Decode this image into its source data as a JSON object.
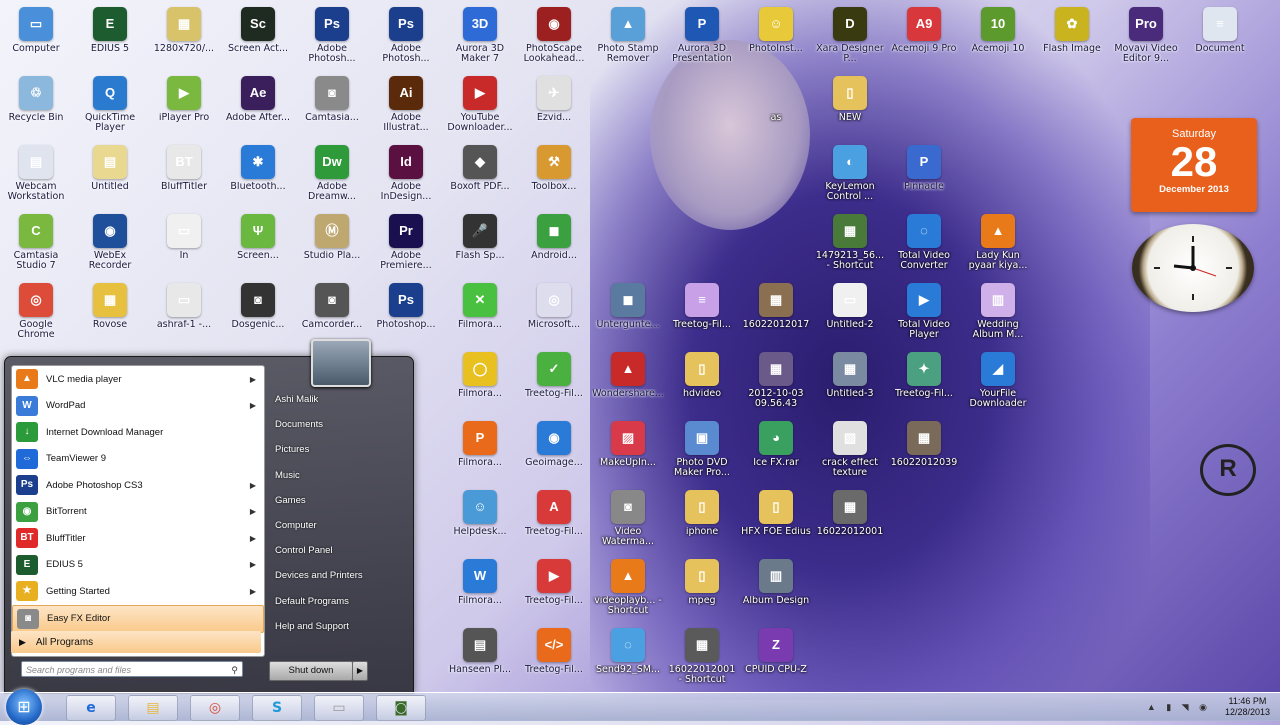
{
  "desktop_icons": [
    {
      "label": "Computer",
      "col": 0,
      "row": 0,
      "color": "#4a8fd9",
      "glyph": "▭"
    },
    {
      "label": "EDIUS 5",
      "col": 1,
      "row": 0,
      "color": "#1d5c2e",
      "glyph": "E"
    },
    {
      "label": "1280x720/...",
      "col": 2,
      "row": 0,
      "color": "#d8c36b",
      "glyph": "▦"
    },
    {
      "label": "Screen Act...",
      "col": 3,
      "row": 0,
      "color": "#1f2a20",
      "glyph": "Sc"
    },
    {
      "label": "Adobe Photosh...",
      "col": 4,
      "row": 0,
      "color": "#1b3f8c",
      "glyph": "Ps"
    },
    {
      "label": "Adobe Photosh...",
      "col": 5,
      "row": 0,
      "color": "#1b3f8c",
      "glyph": "Ps"
    },
    {
      "label": "Aurora 3D Maker 7",
      "col": 6,
      "row": 0,
      "color": "#2e6bd6",
      "glyph": "3D"
    },
    {
      "label": "PhotoScape Lookahead...",
      "col": 7,
      "row": 0,
      "color": "#9c2020",
      "glyph": "◉"
    },
    {
      "label": "Photo Stamp Remover",
      "col": 8,
      "row": 0,
      "color": "#5aa0d8",
      "glyph": "▲"
    },
    {
      "label": "Aurora 3D Presentation",
      "col": 9,
      "row": 0,
      "color": "#1f57b5",
      "glyph": "P"
    },
    {
      "label": "PhotoInst...",
      "col": 10,
      "row": 0,
      "color": "#e8c93a",
      "glyph": "☺"
    },
    {
      "label": "Xara Designer P...",
      "col": 11,
      "row": 0,
      "color": "#3a3a10",
      "glyph": "D"
    },
    {
      "label": "Acemoji 9 Pro",
      "col": 12,
      "row": 0,
      "color": "#d8373b",
      "glyph": "A9"
    },
    {
      "label": "Acemoji 10",
      "col": 13,
      "row": 0,
      "color": "#5c9a2e",
      "glyph": "10"
    },
    {
      "label": "Flash Image",
      "col": 14,
      "row": 0,
      "color": "#c9b420",
      "glyph": "✿"
    },
    {
      "label": "Movavi Video Editor 9...",
      "col": 15,
      "row": 0,
      "color": "#4a2a7a",
      "glyph": "Pro"
    },
    {
      "label": "Document",
      "col": 16,
      "row": 0,
      "color": "#dfe6f0",
      "glyph": "≡"
    },
    {
      "label": "Recycle Bin",
      "col": 0,
      "row": 1,
      "color": "#8db8de",
      "glyph": "♲"
    },
    {
      "label": "QuickTime Player",
      "col": 1,
      "row": 1,
      "color": "#2a7bd0",
      "glyph": "Q"
    },
    {
      "label": "iPlayer Pro",
      "col": 2,
      "row": 1,
      "color": "#7ab840",
      "glyph": "▶"
    },
    {
      "label": "Adobe After...",
      "col": 3,
      "row": 1,
      "color": "#3a1f5c",
      "glyph": "Ae"
    },
    {
      "label": "Camtasia...",
      "col": 4,
      "row": 1,
      "color": "#8a8a8a",
      "glyph": "◙"
    },
    {
      "label": "Adobe Illustrat...",
      "col": 5,
      "row": 1,
      "color": "#5a2a0a",
      "glyph": "Ai"
    },
    {
      "label": "YouTube Downloader...",
      "col": 6,
      "row": 1,
      "color": "#c82a2a",
      "glyph": "▶"
    },
    {
      "label": "Ezvid...",
      "col": 7,
      "row": 1,
      "color": "#e0e0e0",
      "glyph": "✈"
    },
    {
      "label": "as",
      "col": 10,
      "row": 1,
      "color": "rgba(0,0,0,0)",
      "glyph": "",
      "dark": true
    },
    {
      "label": "NEW",
      "col": 11,
      "row": 1,
      "color": "#e6c25c",
      "glyph": "▯",
      "dark": true
    },
    {
      "label": "Webcam Workstation",
      "col": 0,
      "row": 2,
      "color": "#dfe4ee",
      "glyph": "▤"
    },
    {
      "label": "Untitled",
      "col": 1,
      "row": 2,
      "color": "#e8d890",
      "glyph": "▤"
    },
    {
      "label": "BluffTitler",
      "col": 2,
      "row": 2,
      "color": "#e8e8e8",
      "glyph": "BT"
    },
    {
      "label": "Bluetooth...",
      "col": 3,
      "row": 2,
      "color": "#2a7ad8",
      "glyph": "✱"
    },
    {
      "label": "Adobe Dreamw...",
      "col": 4,
      "row": 2,
      "color": "#2e9a3a",
      "glyph": "Dw"
    },
    {
      "label": "Adobe InDesign...",
      "col": 5,
      "row": 2,
      "color": "#5a1040",
      "glyph": "Id"
    },
    {
      "label": "Boxoft PDF...",
      "col": 6,
      "row": 2,
      "color": "#555",
      "glyph": "◆"
    },
    {
      "label": "Toolbox...",
      "col": 7,
      "row": 2,
      "color": "#d89a30",
      "glyph": "⚒"
    },
    {
      "label": "KeyLemon Control ...",
      "col": 11,
      "row": 2,
      "color": "#4aa0e0",
      "glyph": "◐",
      "dark": true
    },
    {
      "label": "Pinnacle",
      "col": 12,
      "row": 2,
      "color": "#3a6ad0",
      "glyph": "P"
    },
    {
      "label": "Camtasia Studio 7",
      "col": 0,
      "row": 3,
      "color": "#7ab840",
      "glyph": "C"
    },
    {
      "label": "WebEx Recorder",
      "col": 1,
      "row": 3,
      "color": "#1f4f9a",
      "glyph": "◉"
    },
    {
      "label": "In",
      "col": 2,
      "row": 3,
      "color": "#f0f0f0",
      "glyph": "▭"
    },
    {
      "label": "Screen...",
      "col": 3,
      "row": 3,
      "color": "#6ab840",
      "glyph": "Ψ"
    },
    {
      "label": "Studio Pla...",
      "col": 4,
      "row": 3,
      "color": "#bfa870",
      "glyph": "Ⓜ"
    },
    {
      "label": "Adobe Premiere...",
      "col": 5,
      "row": 3,
      "color": "#1a1050",
      "glyph": "Pr"
    },
    {
      "label": "Flash Sp...",
      "col": 6,
      "row": 3,
      "color": "#333",
      "glyph": "🎤"
    },
    {
      "label": "Android...",
      "col": 7,
      "row": 3,
      "color": "#3aa040",
      "glyph": "◼"
    },
    {
      "label": "1479213_56... - Shortcut",
      "col": 11,
      "row": 3,
      "color": "#4a7a3a",
      "glyph": "▦",
      "dark": true
    },
    {
      "label": "Total Video Converter",
      "col": 12,
      "row": 3,
      "color": "#2a7ad8",
      "glyph": "◌",
      "dark": true
    },
    {
      "label": "Lady Kun pyaar kiya...",
      "col": 13,
      "row": 3,
      "color": "#e87a1a",
      "glyph": "▲",
      "dark": true
    },
    {
      "label": "Google Chrome",
      "col": 0,
      "row": 4,
      "color": "#dd4b39",
      "glyph": "◎"
    },
    {
      "label": "Rovose",
      "col": 1,
      "row": 4,
      "color": "#e8c040",
      "glyph": "▦"
    },
    {
      "label": "ashraf-1 -...",
      "col": 2,
      "row": 4,
      "color": "#e8e8e8",
      "glyph": "▭"
    },
    {
      "label": "Dosgenic...",
      "col": 3,
      "row": 4,
      "color": "#333",
      "glyph": "◙"
    },
    {
      "label": "Camcorder...",
      "col": 4,
      "row": 4,
      "color": "#555",
      "glyph": "◙"
    },
    {
      "label": "Photoshop...",
      "col": 5,
      "row": 4,
      "color": "#1b3f8c",
      "glyph": "Ps"
    },
    {
      "label": "Filmora...",
      "col": 6,
      "row": 4,
      "color": "#4ac040",
      "glyph": "✕"
    },
    {
      "label": "Microsoft...",
      "col": 7,
      "row": 4,
      "color": "#dde",
      "glyph": "◎"
    },
    {
      "label": "Untergunte...",
      "col": 8,
      "row": 4,
      "color": "#5a7aa0",
      "glyph": "◼"
    },
    {
      "label": "Treetog-Fil...",
      "col": 9,
      "row": 4,
      "color": "#c8a0e8",
      "glyph": "≡",
      "dark": true
    },
    {
      "label": "16022012017",
      "col": 10,
      "row": 4,
      "color": "#8a7050",
      "glyph": "▦",
      "dark": true
    },
    {
      "label": "Untitled-2",
      "col": 11,
      "row": 4,
      "color": "#f0f0f0",
      "glyph": "▭",
      "dark": true
    },
    {
      "label": "Total Video Player",
      "col": 12,
      "row": 4,
      "color": "#2a7ad8",
      "glyph": "▶",
      "dark": true
    },
    {
      "label": "Wedding Album M...",
      "col": 13,
      "row": 4,
      "color": "#d0b0e8",
      "glyph": "▥",
      "dark": true
    },
    {
      "label": "Filmora...",
      "col": 6,
      "row": 5,
      "color": "#e8c020",
      "glyph": "◯"
    },
    {
      "label": "Treetog-Fil...",
      "col": 7,
      "row": 5,
      "color": "#4ab040",
      "glyph": "✓"
    },
    {
      "label": "Wondershare...",
      "col": 8,
      "row": 5,
      "color": "#c82a2a",
      "glyph": "▲"
    },
    {
      "label": "hdvideo",
      "col": 9,
      "row": 5,
      "color": "#e6c25c",
      "glyph": "▯",
      "dark": true
    },
    {
      "label": "2012-10-03 09.56.43",
      "col": 10,
      "row": 5,
      "color": "#6a5a8a",
      "glyph": "▦",
      "dark": true
    },
    {
      "label": "Untitled-3",
      "col": 11,
      "row": 5,
      "color": "#7a8aa0",
      "glyph": "▦",
      "dark": true
    },
    {
      "label": "Treetog-Fil...",
      "col": 12,
      "row": 5,
      "color": "#4aa080",
      "glyph": "✦",
      "dark": true
    },
    {
      "label": "YourFile Downloader",
      "col": 13,
      "row": 5,
      "color": "#2a7ad8",
      "glyph": "◢",
      "dark": true
    },
    {
      "label": "Filmora...",
      "col": 6,
      "row": 6,
      "color": "#e86a1a",
      "glyph": "P"
    },
    {
      "label": "Geoimage...",
      "col": 7,
      "row": 6,
      "color": "#2a7ad8",
      "glyph": "◉"
    },
    {
      "label": "MakeUpIn...",
      "col": 8,
      "row": 6,
      "color": "#d83a4a",
      "glyph": "▨",
      "dark": true
    },
    {
      "label": "Photo DVD Maker Pro...",
      "col": 9,
      "row": 6,
      "color": "#5a8ad0",
      "glyph": "▣",
      "dark": true
    },
    {
      "label": "Ice FX.rar",
      "col": 10,
      "row": 6,
      "color": "#3aa060",
      "glyph": "◕",
      "dark": true
    },
    {
      "label": "crack effect texture",
      "col": 11,
      "row": 6,
      "color": "#e0e0e0",
      "glyph": "▧",
      "dark": true
    },
    {
      "label": "16022012039",
      "col": 12,
      "row": 6,
      "color": "#7a6a5a",
      "glyph": "▦",
      "dark": true
    },
    {
      "label": "Helpdesk...",
      "col": 6,
      "row": 7,
      "color": "#4a9ad8",
      "glyph": "☺"
    },
    {
      "label": "Treetog-Fil...",
      "col": 7,
      "row": 7,
      "color": "#d83a3a",
      "glyph": "A"
    },
    {
      "label": "Video Waterma...",
      "col": 8,
      "row": 7,
      "color": "#888",
      "glyph": "◙",
      "dark": true
    },
    {
      "label": "iphone",
      "col": 9,
      "row": 7,
      "color": "#e6c25c",
      "glyph": "▯",
      "dark": true
    },
    {
      "label": "HFX FOE Edius",
      "col": 10,
      "row": 7,
      "color": "#e6c25c",
      "glyph": "▯",
      "dark": true
    },
    {
      "label": "16022012001",
      "col": 11,
      "row": 7,
      "color": "#6a6a6a",
      "glyph": "▦",
      "dark": true
    },
    {
      "label": "Filmora...",
      "col": 6,
      "row": 8,
      "color": "#2a7ad8",
      "glyph": "W"
    },
    {
      "label": "Treetog-Fil...",
      "col": 7,
      "row": 8,
      "color": "#d83a3a",
      "glyph": "▶"
    },
    {
      "label": "videoplayb... - Shortcut",
      "col": 8,
      "row": 8,
      "color": "#e87a1a",
      "glyph": "▲",
      "dark": true
    },
    {
      "label": "mpeg",
      "col": 9,
      "row": 8,
      "color": "#e6c25c",
      "glyph": "▯",
      "dark": true
    },
    {
      "label": "Album Design",
      "col": 10,
      "row": 8,
      "color": "#6a7a8a",
      "glyph": "▥",
      "dark": true
    },
    {
      "label": "Hanseen Pl...",
      "col": 6,
      "row": 9,
      "color": "#555",
      "glyph": "▤"
    },
    {
      "label": "Treetog-Fil...",
      "col": 7,
      "row": 9,
      "color": "#e86a1a",
      "glyph": "</>"
    },
    {
      "label": "Send92_SM...",
      "col": 8,
      "row": 9,
      "color": "#4aa0e0",
      "glyph": "◌",
      "dark": true
    },
    {
      "label": "16022012001 - Shortcut",
      "col": 9,
      "row": 9,
      "color": "#5a5a5a",
      "glyph": "▦",
      "dark": true
    },
    {
      "label": "CPUID CPU-Z",
      "col": 10,
      "row": 9,
      "color": "#7a3ab0",
      "glyph": "Z",
      "dark": true
    }
  ],
  "gadgets": {
    "calendar": {
      "weekday": "Saturday",
      "day": "28",
      "month_year": "December 2013"
    },
    "registered_mark": "R"
  },
  "start_menu": {
    "programs": [
      {
        "label": "VLC media player",
        "color": "#e87a1a",
        "glyph": "▲",
        "arrow": true
      },
      {
        "label": "WordPad",
        "color": "#3a7ad8",
        "glyph": "W",
        "arrow": true
      },
      {
        "label": "Internet Download Manager",
        "color": "#2a9a3a",
        "glyph": "↓",
        "arrow": false
      },
      {
        "label": "TeamViewer 9",
        "color": "#1f6ad8",
        "glyph": "⇔",
        "arrow": false
      },
      {
        "label": "Adobe Photoshop CS3",
        "color": "#1b3f8c",
        "glyph": "Ps",
        "arrow": true
      },
      {
        "label": "BitTorrent",
        "color": "#3aa040",
        "glyph": "◉",
        "arrow": true
      },
      {
        "label": "BluffTitler",
        "color": "#e02a2a",
        "glyph": "BT",
        "arrow": true
      },
      {
        "label": "EDIUS 5",
        "color": "#1d5c2e",
        "glyph": "E",
        "arrow": true
      },
      {
        "label": "Getting Started",
        "color": "#e8b020",
        "glyph": "★",
        "arrow": true
      },
      {
        "label": "Easy FX Editor",
        "color": "#8a8a8a",
        "glyph": "◙",
        "arrow": false,
        "highlight": true
      }
    ],
    "all_programs": "All Programs",
    "search_placeholder": "Search programs and files",
    "right_items": [
      "Ashi Malik",
      "Documents",
      "Pictures",
      "Music",
      "Games",
      "Computer",
      "Control Panel",
      "Devices and Printers",
      "Default Programs",
      "Help and Support"
    ],
    "shutdown_label": "Shut down"
  },
  "taskbar": {
    "pinned": [
      {
        "name": "ie",
        "glyph": "e",
        "color": "#1f6ad8"
      },
      {
        "name": "explorer",
        "glyph": "▤",
        "color": "#e6b840"
      },
      {
        "name": "chrome",
        "glyph": "◎",
        "color": "#dd4b39"
      },
      {
        "name": "skype",
        "glyph": "S",
        "color": "#1f9ad8"
      },
      {
        "name": "media",
        "glyph": "▭",
        "color": "#999"
      },
      {
        "name": "camtasia",
        "glyph": "◙",
        "color": "#3a6a2a"
      }
    ],
    "time": "11:46 PM",
    "date": "12/28/2013"
  }
}
